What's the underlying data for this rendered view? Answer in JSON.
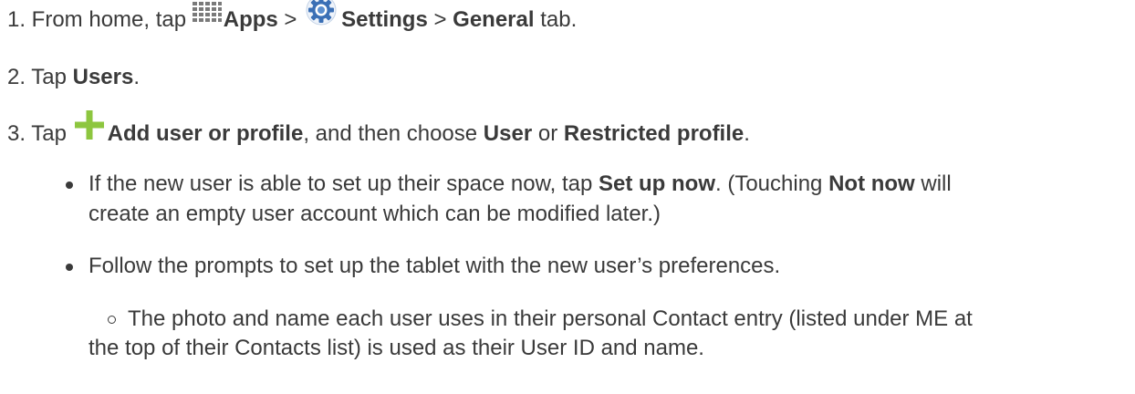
{
  "steps": [
    {
      "number": "1.",
      "t1": " From home, tap ",
      "apps": "Apps",
      "t2": " > ",
      "settings": "Settings",
      "t3": " > ",
      "general": "General",
      "t4": " tab."
    },
    {
      "number": "2.",
      "t1": " Tap ",
      "users": "Users",
      "t2": "."
    },
    {
      "number": "3.",
      "t1": " Tap ",
      "add": "Add user or profile",
      "t2": ", and then choose ",
      "user": "User",
      "t3": " or ",
      "restricted": "Restricted profile",
      "t4": "."
    }
  ],
  "bullets": [
    {
      "line1_a": "If the new user is able to set up their space now, tap ",
      "setup": "Set up now",
      "line1_b": ". (Touching ",
      "notnow": "Not now",
      "line1_c": " will",
      "line2": "create an empty user account which can be modified later.)"
    },
    {
      "text": "Follow the prompts to set up the tablet with the new user’s preferences."
    }
  ],
  "subbullets": [
    {
      "line1": "The photo and name each user uses in their personal Contact entry (listed under ME at",
      "line2": "the top of their Contacts list) is used as their User ID and name."
    }
  ],
  "icons": {
    "apps": "apps-grid-icon",
    "settings": "settings-gear-icon",
    "add": "plus-icon"
  },
  "colors": {
    "text": "#3a3a3a",
    "plus": "#8dc63f",
    "gear": "#3a6fb5"
  }
}
